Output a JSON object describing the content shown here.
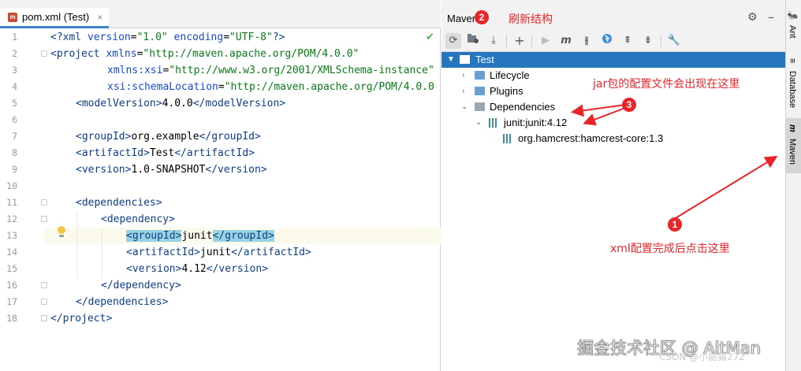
{
  "editor": {
    "tab_label": "pom.xml (Test)",
    "line_numbers": [
      "1",
      "2",
      "3",
      "4",
      "5",
      "6",
      "7",
      "8",
      "9",
      "10",
      "11",
      "12",
      "13",
      "14",
      "15",
      "16",
      "17",
      "18"
    ],
    "lines": {
      "l1_tag": "<?xml",
      "l1_a1": " version",
      "l1_eq1": "=",
      "l1_v1": "\"1.0\"",
      "l1_a2": " encoding",
      "l1_eq2": "=",
      "l1_v2": "\"UTF-8\"",
      "l1_end": "?>",
      "l2_tag": "<project",
      "l2_a": " xmlns",
      "l2_eq": "=",
      "l2_v": "\"http://maven.apache.org/POM/4.0.0\"",
      "l3_a": "xmlns:xsi",
      "l3_eq": "=",
      "l3_v": "\"http://www.w3.org/2001/XMLSchema-instance\"",
      "l4_a": "xsi:schemaLocation",
      "l4_eq": "=",
      "l4_v": "\"http://maven.apache.org/POM/4.0.0",
      "l5_open": "<modelVersion>",
      "l5_text": "4.0.0",
      "l5_close": "</modelVersion>",
      "l7_open": "<groupId>",
      "l7_text": "org.example",
      "l7_close": "</groupId>",
      "l8_open": "<artifactId>",
      "l8_text": "Test",
      "l8_close": "</artifactId>",
      "l9_open": "<version>",
      "l9_text": "1.0-SNAPSHOT",
      "l9_close": "</version>",
      "l11": "<dependencies>",
      "l12": "<dependency>",
      "l13_open": "<groupId>",
      "l13_text": "junit",
      "l13_close": "</groupId>",
      "l14_open": "<artifactId>",
      "l14_text": "junit",
      "l14_close": "</artifactId>",
      "l15_open": "<version>",
      "l15_text": "4.12",
      "l15_close": "</version>",
      "l16": "</dependency>",
      "l17": "</dependencies>",
      "l18": "</project>"
    }
  },
  "maven": {
    "title": "Maven",
    "toolbar_icons": [
      "refresh-icon",
      "add-maven-project-icon",
      "download-icon",
      "plus-icon",
      "run-icon",
      "maven-goal-icon",
      "toggle-offline-icon",
      "skip-tests-icon",
      "show-dependencies-icon",
      "collapse-icon",
      "settings-wrench-icon"
    ],
    "tree": {
      "root": "Test",
      "lifecycle": "Lifecycle",
      "plugins": "Plugins",
      "dependencies": "Dependencies",
      "junit": "junit:junit:4.12",
      "hamcrest": "org.hamcrest:hamcrest-core:1.3"
    }
  },
  "side_strip": {
    "ant": "Ant",
    "database": "Database",
    "maven": "Maven"
  },
  "annotations": {
    "refresh_label": "刷新结构",
    "jar_label": "jar包的配置文件会出现在这里",
    "click_label": "xml配置完成后点击这里",
    "badge1": "1",
    "badge2": "2",
    "badge3": "3",
    "color": "#e8262a"
  },
  "watermarks": {
    "main": "掘金技术社区 @ AltMan",
    "csdn": "CSDN @小能猫272"
  }
}
